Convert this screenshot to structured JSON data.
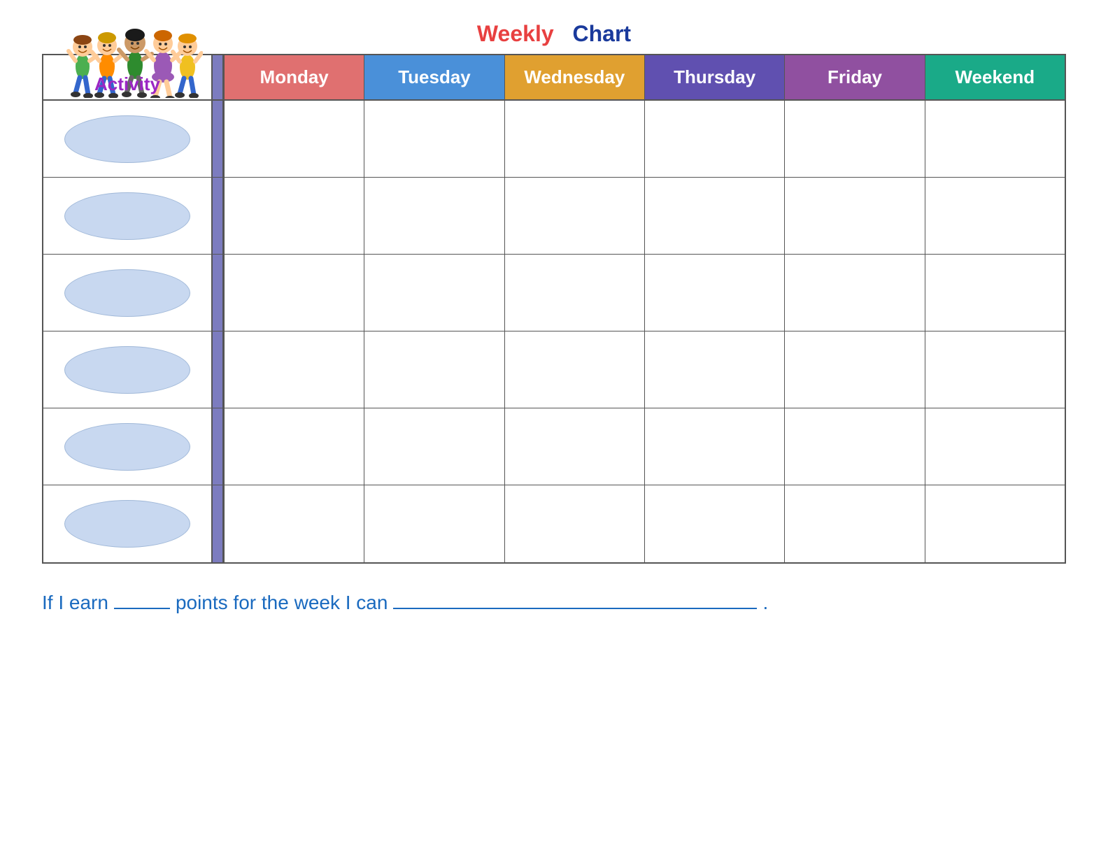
{
  "title": {
    "weekly": "Weekly",
    "chart": "Chart"
  },
  "activity_label": "Activity",
  "days": [
    {
      "id": "monday",
      "label": "Monday",
      "class": "day-monday"
    },
    {
      "id": "tuesday",
      "label": "Tuesday",
      "class": "day-tuesday"
    },
    {
      "id": "wednesday",
      "label": "Wednesday",
      "class": "day-wednesday"
    },
    {
      "id": "thursday",
      "label": "Thursday",
      "class": "day-thursday"
    },
    {
      "id": "friday",
      "label": "Friday",
      "class": "day-friday"
    },
    {
      "id": "weekend",
      "label": "Weekend",
      "class": "day-weekend"
    }
  ],
  "rows": [
    0,
    1,
    2,
    3,
    4,
    5
  ],
  "footer": {
    "text1": "If I earn ",
    "text2": " points for the week I can ",
    "text3": "."
  }
}
